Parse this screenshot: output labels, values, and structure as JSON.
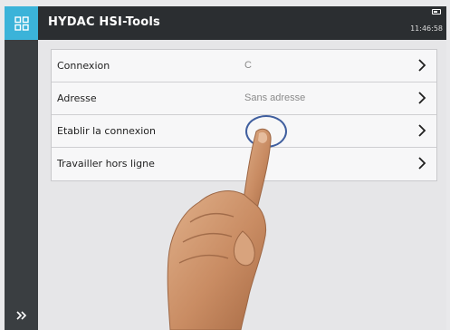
{
  "header": {
    "title": "HYDAC HSI-Tools",
    "time": "11:46:58"
  },
  "menu": {
    "items": [
      {
        "label": "Connexion",
        "value": "C"
      },
      {
        "label": "Adresse",
        "value": "Sans adresse"
      },
      {
        "label": "Etablir la connexion",
        "value": ""
      },
      {
        "label": "Travailler hors ligne",
        "value": ""
      }
    ]
  },
  "icons": {
    "menu": "grid-icon",
    "expand": "double-chevron-right-icon",
    "battery": "battery-icon",
    "row_arrow": "chevron-right-icon"
  },
  "colors": {
    "accent": "#3bb3d9",
    "header_bg": "#2b2e31",
    "sidebar_bg": "#3a3e41",
    "tap_circle": "#3f5e9e"
  }
}
